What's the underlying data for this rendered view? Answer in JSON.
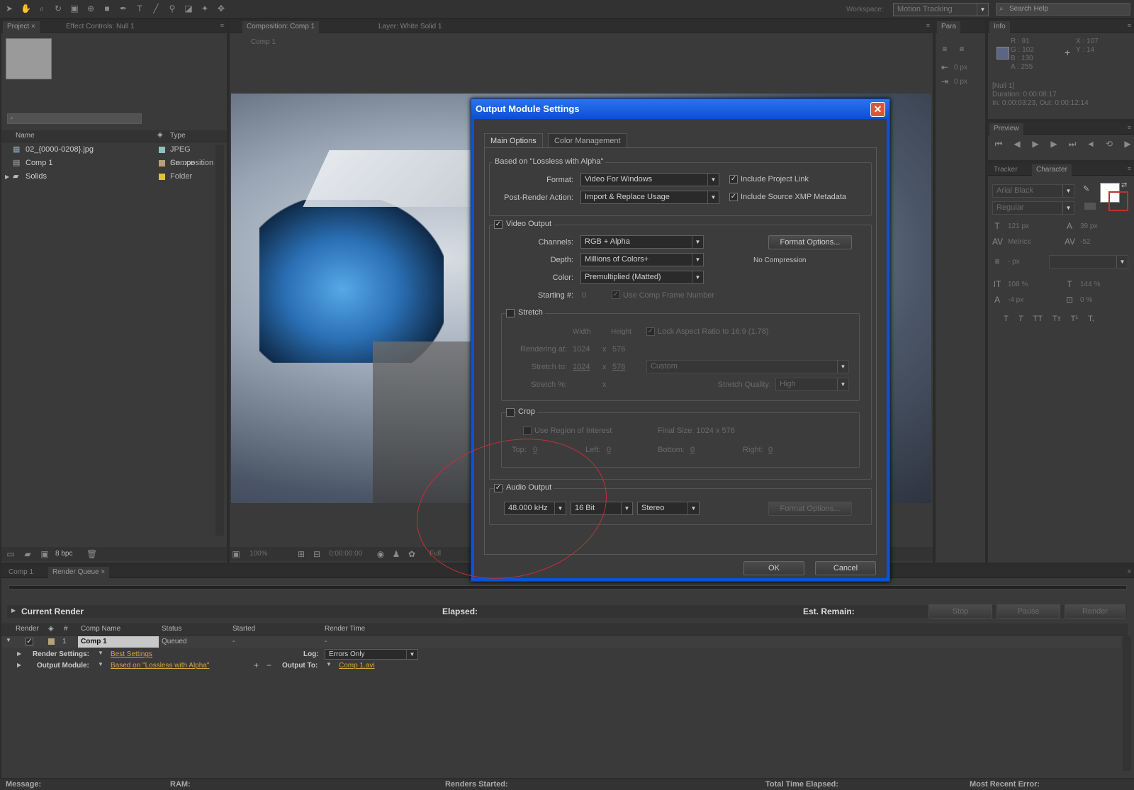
{
  "toolbar": {
    "workspace_label": "Workspace:",
    "workspace_value": "Motion Tracking",
    "search_placeholder": "Search Help"
  },
  "project_panel": {
    "tabs": [
      "Project ×",
      "Effect Controls: Null 1"
    ],
    "columns": [
      "Name",
      "Type"
    ],
    "items": [
      {
        "name": "02_{0000-0208}.jpg",
        "type": "JPEG Se...ce",
        "swatch": "#8fc0c0"
      },
      {
        "name": "Comp 1",
        "type": "Composition",
        "swatch": "#b8a27a"
      },
      {
        "name": "Solids",
        "type": "Folder",
        "swatch": "#e0c040"
      }
    ],
    "bpc": "8 bpc"
  },
  "composition_panel": {
    "tabs": [
      "Composition: Comp 1",
      "Layer: White Solid 1"
    ],
    "breadcrumb": "Comp 1",
    "zoom": "100%",
    "timecode": "0:00:00:00",
    "resolution": "Full"
  },
  "paragraph_panel": {
    "tab": "Para",
    "indent_left": "0 px",
    "indent_right": "0 px"
  },
  "info_panel": {
    "tab": "Info",
    "r": "R : 91",
    "g": "G : 102",
    "b": "B : 130",
    "a": "A : 255",
    "x": "X : 107",
    "y": "Y : 14",
    "layer": "[Null 1]",
    "duration": "Duration: 0:00:08:17",
    "inout": "In: 0:00:03:23, Out: 0:00:12:14"
  },
  "preview_panel": {
    "tab": "Preview"
  },
  "character_panel": {
    "tabs": [
      "Tracker",
      "Character"
    ],
    "font": "Arial Black",
    "style": "Regular",
    "size": "121 px",
    "leading": "39 px",
    "kerning": "Metrics",
    "tracking": "-52",
    "stroke": "- px",
    "vscale": "108 %",
    "hscale": "144 %",
    "baseline": "-4 px",
    "tsume": "0 %",
    "styles": [
      "T",
      "T",
      "TT",
      "Tт",
      "T¹",
      "T,"
    ]
  },
  "dialog": {
    "title": "Output Module Settings",
    "tabs": [
      "Main Options",
      "Color Management"
    ],
    "based_on": "Based on \"Lossless with Alpha\"",
    "format_label": "Format:",
    "format_value": "Video For Windows",
    "post_render_label": "Post-Render Action:",
    "post_render_value": "Import & Replace Usage",
    "include_project_link": "Include Project Link",
    "include_xmp": "Include Source XMP Metadata",
    "video_output": "Video Output",
    "channels_label": "Channels:",
    "channels_value": "RGB + Alpha",
    "depth_label": "Depth:",
    "depth_value": "Millions of Colors+",
    "color_label": "Color:",
    "color_value": "Premultiplied (Matted)",
    "starting_label": "Starting #:",
    "starting_value": "0",
    "use_comp_frame": "Use Comp Frame Number",
    "format_options": "Format Options...",
    "compression": "No Compression",
    "stretch": "Stretch",
    "width_label": "Width",
    "height_label": "Height",
    "lock_aspect": "Lock Aspect Ratio to 16:9 (1.78)",
    "rendering_at_label": "Rendering at:",
    "rendering_w": "1024",
    "rendering_h": "576",
    "stretch_to_label": "Stretch to:",
    "stretch_w": "1024",
    "stretch_h": "576",
    "stretch_preset": "Custom",
    "stretch_pct_label": "Stretch %:",
    "x_sep": "x",
    "stretch_quality_label": "Stretch Quality:",
    "stretch_quality": "High",
    "crop": "Crop",
    "use_roi": "Use Region of Interest",
    "final_size": "Final Size: 1024 x 576",
    "top_label": "Top:",
    "top": "0",
    "left_label": "Left:",
    "left": "0",
    "bottom_label": "Bottom:",
    "bottom": "0",
    "right_label": "Right:",
    "right": "0",
    "audio_output": "Audio Output",
    "rate": "48.000 kHz",
    "bits": "16 Bit",
    "channels_audio": "Stereo",
    "audio_format_options": "Format Options...",
    "ok": "OK",
    "cancel": "Cancel"
  },
  "render_queue": {
    "tabs": [
      "Comp 1",
      "Render Queue ×"
    ],
    "current_render": "Current Render",
    "elapsed": "Elapsed:",
    "est_remain": "Est. Remain:",
    "stop": "Stop",
    "pause": "Pause",
    "render": "Render",
    "columns": [
      "Render",
      "#",
      "Comp Name",
      "Status",
      "Started",
      "Render Time"
    ],
    "item": {
      "num": "1",
      "comp": "Comp 1",
      "status": "Queued",
      "started": "-",
      "render_time": "-"
    },
    "render_settings_label": "Render Settings:",
    "render_settings_value": "Best Settings",
    "log_label": "Log:",
    "log_value": "Errors Only",
    "output_module_label": "Output Module:",
    "output_module_value": "Based on \"Lossless with Alpha\"",
    "output_to_label": "Output To:",
    "output_to_value": "Comp 1.avi",
    "status_bar": {
      "message": "Message:",
      "ram": "RAM:",
      "renders_started": "Renders Started:",
      "total_time": "Total Time Elapsed:",
      "recent_error": "Most Recent Error:"
    }
  },
  "colors": {
    "dialog_titlebar": "#0a52d8",
    "link": "#d7a53a",
    "info_swatch": "#5b6682",
    "annotation": "#c0303a"
  }
}
